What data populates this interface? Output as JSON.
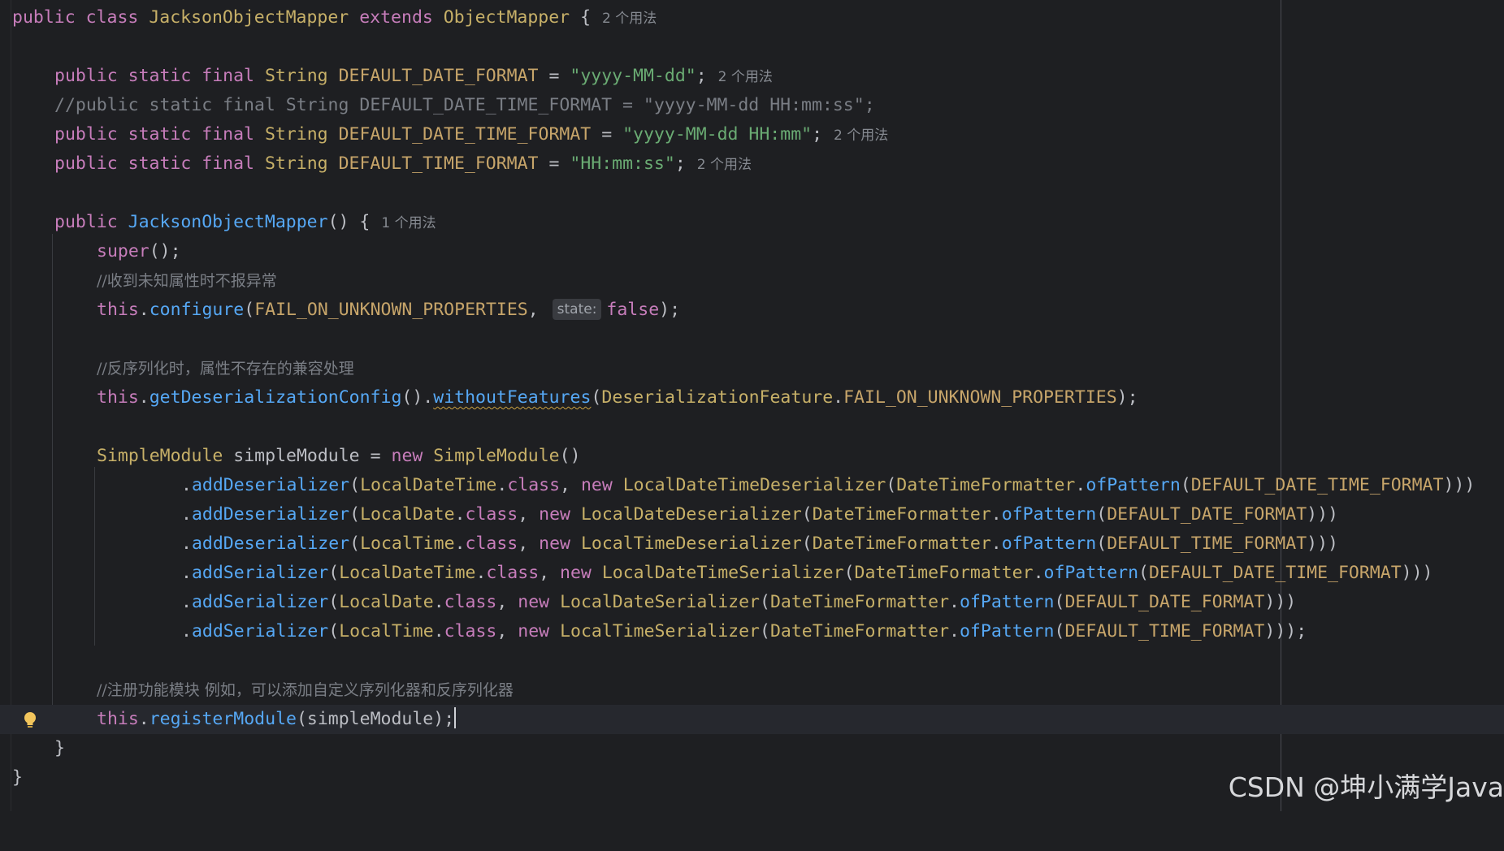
{
  "editor": {
    "usage_hints": {
      "u2": "2 个用法",
      "u1": "1 个用法"
    },
    "param_hint": "state:",
    "watermark": "CSDN @坤小满学Java",
    "tokens": {
      "public": "public",
      "class": "class",
      "static": "static",
      "final": "final",
      "extends": "extends",
      "new": "new",
      "this": "this",
      "super": "super",
      "false_kw": "false",
      "class_kw": "class",
      "String": "String",
      "class_name": "JacksonObjectMapper",
      "base_class": "ObjectMapper",
      "DEFAULT_DATE_FORMAT": "DEFAULT_DATE_FORMAT",
      "DEFAULT_DATE_TIME_FORMAT": "DEFAULT_DATE_TIME_FORMAT",
      "DEFAULT_TIME_FORMAT": "DEFAULT_TIME_FORMAT",
      "date_format_str": "\"yyyy-MM-dd\"",
      "datetime_format_str": "\"yyyy-MM-dd HH:mm\"",
      "time_format_str": "\"HH:mm:ss\"",
      "commented_line": "//public static final String DEFAULT_DATE_TIME_FORMAT = \"yyyy-MM-dd HH:mm:ss\";",
      "comment_unknown": "//收到未知属性时不报异常",
      "comment_compat": "//反序列化时，属性不存在的兼容处理",
      "comment_register": "//注册功能模块 例如，可以添加自定义序列化器和反序列化器",
      "configure": "configure",
      "FAIL_ON_UNKNOWN_PROPERTIES": "FAIL_ON_UNKNOWN_PROPERTIES",
      "getDeserializationConfig": "getDeserializationConfig",
      "withoutFeatures": "withoutFeatures",
      "DeserializationFeature": "DeserializationFeature",
      "SimpleModule": "SimpleModule",
      "simpleModule": "simpleModule",
      "addDeserializer": "addDeserializer",
      "addSerializer": "addSerializer",
      "LocalDateTime": "LocalDateTime",
      "LocalDate": "LocalDate",
      "LocalTime": "LocalTime",
      "LocalDateTimeDeserializer": "LocalDateTimeDeserializer",
      "LocalDateDeserializer": "LocalDateDeserializer",
      "LocalTimeDeserializer": "LocalTimeDeserializer",
      "LocalDateTimeSerializer": "LocalDateTimeSerializer",
      "LocalDateSerializer": "LocalDateSerializer",
      "LocalTimeSerializer": "LocalTimeSerializer",
      "DateTimeFormatter": "DateTimeFormatter",
      "ofPattern": "ofPattern",
      "registerModule": "registerModule"
    }
  }
}
